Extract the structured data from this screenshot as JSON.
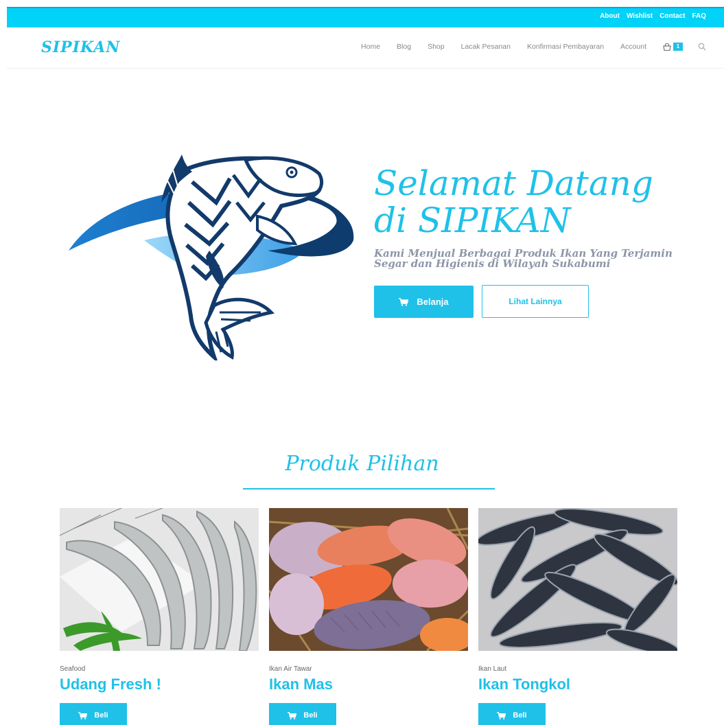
{
  "topbar": {
    "links": [
      "About",
      "Wishlist",
      "Contact",
      "FAQ"
    ]
  },
  "header": {
    "logo": "SIPIKAN",
    "nav": [
      "Home",
      "Blog",
      "Shop",
      "Lacak Pesanan",
      "Konfirmasi Pembayaran",
      "Account"
    ],
    "cart_count": "1",
    "icons": [
      "cart-icon",
      "search-icon"
    ]
  },
  "hero": {
    "title": "Selamat Datang di SIPIKAN",
    "subtitle": "Kami Menjual Berbagai Produk Ikan Yang Terjamin Segar dan Higienis di Wilayah Sukabumi",
    "primary_button": "Belanja",
    "secondary_button": "Lihat Lainnya"
  },
  "products_section": {
    "title": "Produk Pilihan",
    "items": [
      {
        "category": "Seafood",
        "name": "Udang Fresh !",
        "button": "Beli"
      },
      {
        "category": "Ikan Air Tawar",
        "name": "Ikan Mas",
        "button": "Beli"
      },
      {
        "category": "Ikan Laut",
        "name": "Ikan Tongkol",
        "button": "Beli"
      }
    ]
  },
  "colors": {
    "accent": "#1fc1e8",
    "topbar": "#00d2f8",
    "logo_dark": "#123a6b",
    "logo_blue": "#1e78c8"
  }
}
